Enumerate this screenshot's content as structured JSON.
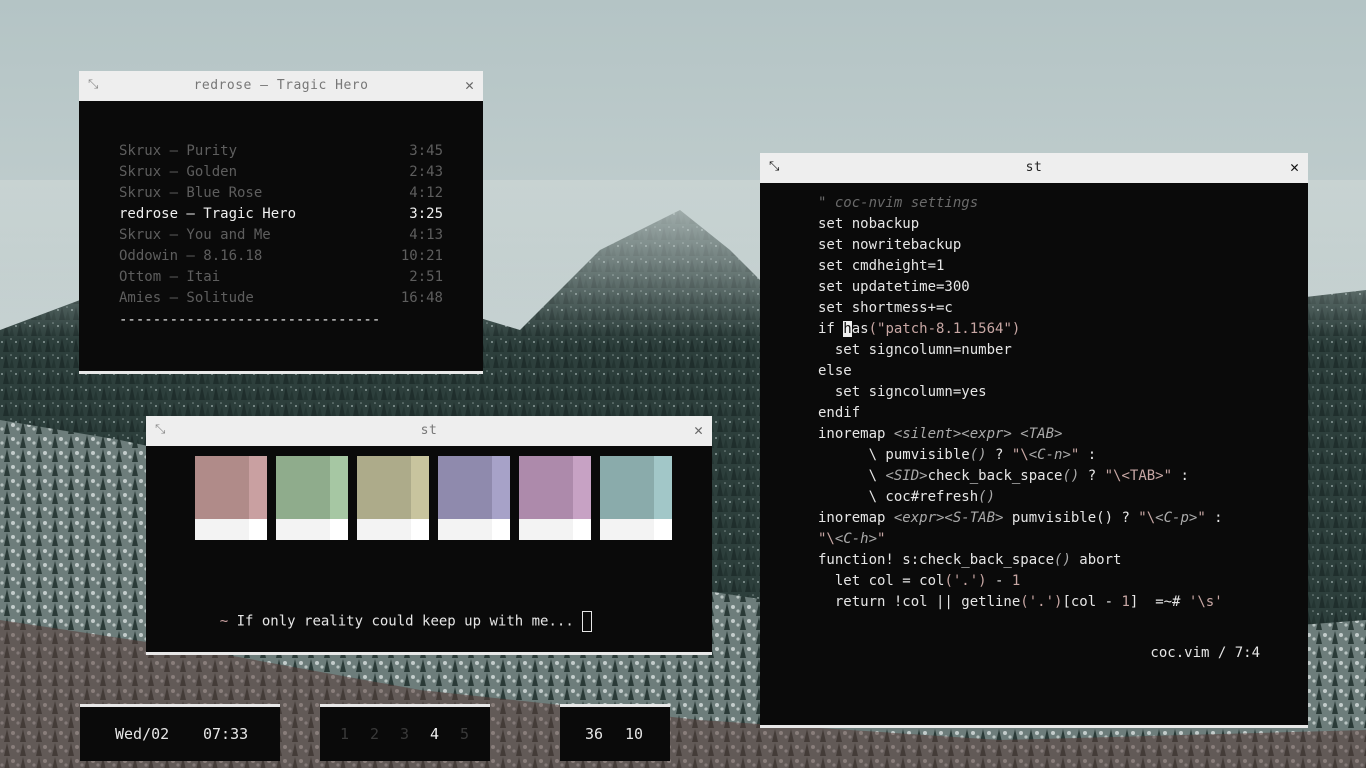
{
  "music_window": {
    "title": "redrose – Tragic Hero",
    "tracks": [
      {
        "name": "Skrux – Purity",
        "duration": "3:45",
        "active": false
      },
      {
        "name": "Skrux – Golden",
        "duration": "2:43",
        "active": false
      },
      {
        "name": "Skrux – Blue Rose",
        "duration": "4:12",
        "active": false
      },
      {
        "name": "redrose – Tragic Hero",
        "duration": "3:25",
        "active": true
      },
      {
        "name": "Skrux – You and Me",
        "duration": "4:13",
        "active": false
      },
      {
        "name": "Oddowin – 8.16.18",
        "duration": "10:21",
        "active": false
      },
      {
        "name": "Ottom – Itai",
        "duration": "2:51",
        "active": false
      },
      {
        "name": "Amies – Solitude",
        "duration": "16:48",
        "active": false
      }
    ],
    "progress_line": "-------------------------------"
  },
  "colors_window": {
    "title": "st",
    "swatches": [
      {
        "main": "#b08b89",
        "accent": "#c9a0a1"
      },
      {
        "main": "#8fac8c",
        "accent": "#a6c7a3"
      },
      {
        "main": "#adab8a",
        "accent": "#c8c49e"
      },
      {
        "main": "#8f8aad",
        "accent": "#a7a2c8"
      },
      {
        "main": "#ad8aab",
        "accent": "#c7a2c4"
      },
      {
        "main": "#8aabab",
        "accent": "#a2c7c8"
      }
    ],
    "prompt_symbol": "~",
    "prompt_text": "If only reality could keep up with me..."
  },
  "editor_window": {
    "title": "st",
    "status": "coc.vim / 7:4"
  },
  "bars": {
    "date": "Wed/02",
    "time": "07:33",
    "workspaces": [
      {
        "label": "1",
        "active": false
      },
      {
        "label": "2",
        "active": false
      },
      {
        "label": "3",
        "active": false
      },
      {
        "label": "4",
        "active": true
      },
      {
        "label": "5",
        "active": false
      }
    ],
    "stat_a": "36",
    "stat_b": "10"
  },
  "icons": {
    "resize": "resize-arrows-icon",
    "close": "close-icon"
  }
}
